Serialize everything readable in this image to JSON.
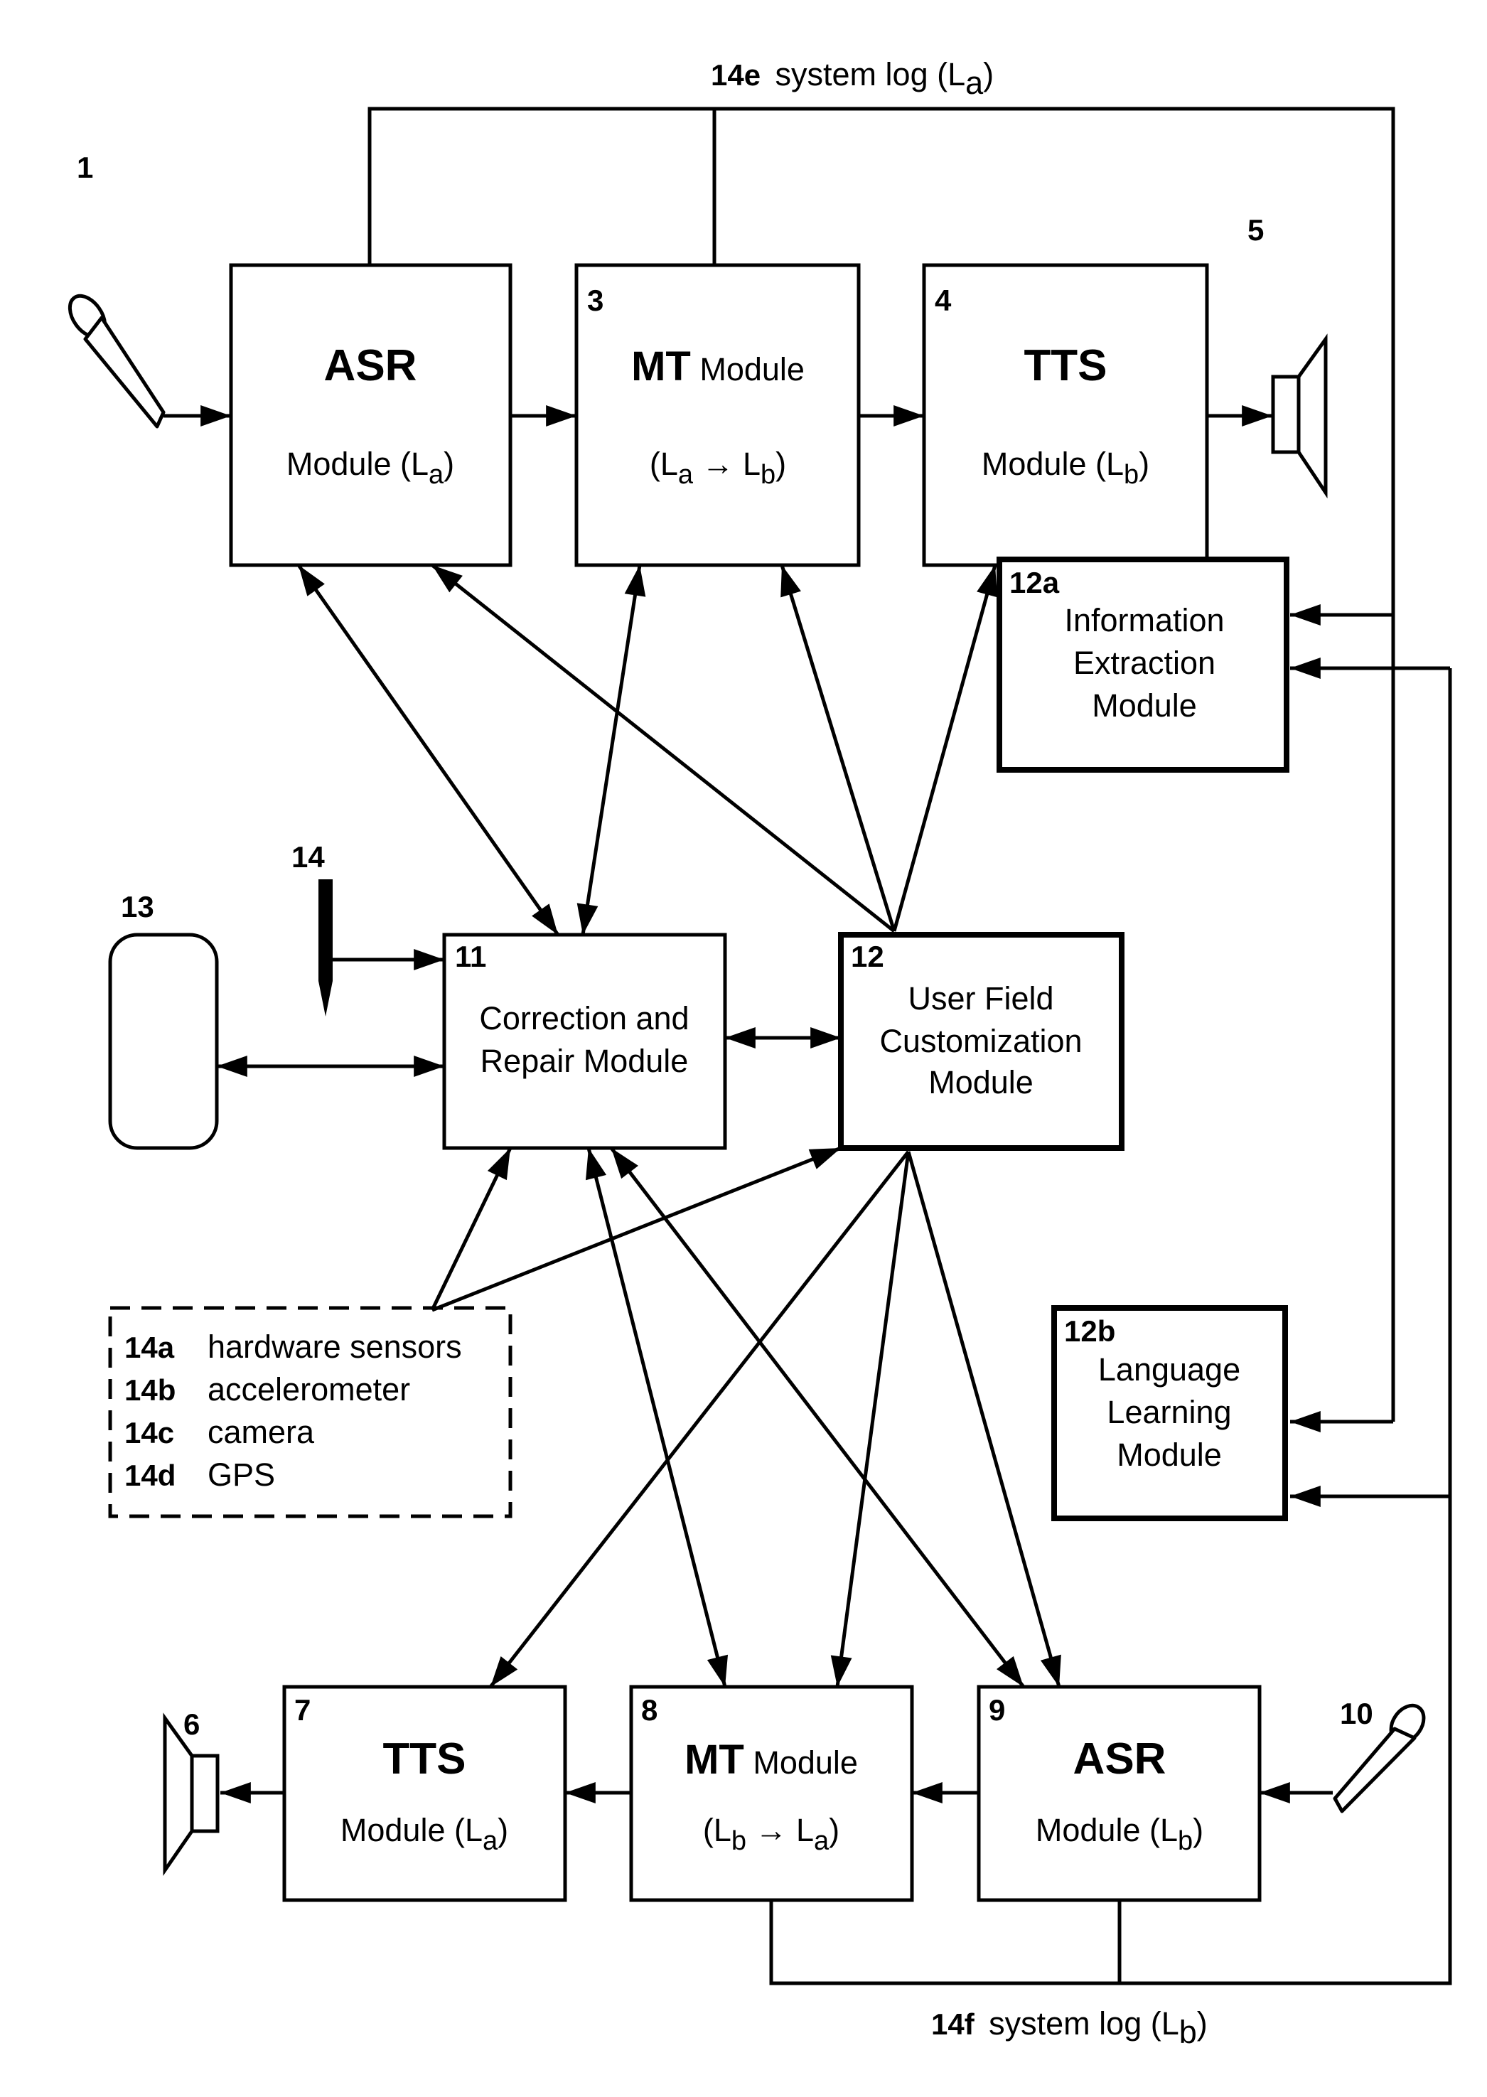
{
  "figure": {
    "type": "block-diagram",
    "description": "Speech-to-speech translation system with user field customization"
  },
  "system_logs": {
    "top": {
      "ref": "14e",
      "label": "system log (L",
      "sub": "a",
      "close": ")"
    },
    "bottom": {
      "ref": "14f",
      "label": "system log (L",
      "sub": "b",
      "close": ")"
    }
  },
  "devices": {
    "mic_top": {
      "ref": "1",
      "icon": "microphone-icon"
    },
    "speaker_top": {
      "ref": "5",
      "icon": "speaker-icon"
    },
    "speaker_bottom": {
      "ref": "6",
      "icon": "speaker-icon"
    },
    "mic_bottom": {
      "ref": "10",
      "icon": "microphone-icon"
    },
    "display": {
      "ref": "13",
      "icon": "display-device-icon"
    },
    "pen": {
      "ref": "14",
      "icon": "stylus-pen-icon"
    }
  },
  "modules": {
    "asr_a": {
      "ref": "",
      "title": "ASR",
      "line2": "Module (L",
      "sub": "a",
      "close": ")"
    },
    "mt_ab": {
      "ref": "3",
      "title": "MT",
      "title_rest": " Module",
      "line2_open": "(L",
      "sub1": "a",
      "arrow": " → L",
      "sub2": "b",
      "close": ")"
    },
    "tts_b": {
      "ref": "4",
      "title": "TTS",
      "line2": "Module (L",
      "sub": "b",
      "close": ")"
    },
    "tts_a": {
      "ref": "7",
      "title": "TTS",
      "line2": "Module (L",
      "sub": "a",
      "close": ")"
    },
    "mt_ba": {
      "ref": "8",
      "title": "MT",
      "title_rest": " Module",
      "line2_open": "(L",
      "sub1": "b",
      "arrow": " → L",
      "sub2": "a",
      "close": ")"
    },
    "asr_b": {
      "ref": "9",
      "title": "ASR",
      "line2": "Module (L",
      "sub": "b",
      "close": ")"
    },
    "correction": {
      "ref": "11",
      "lines": [
        "Correction and",
        "Repair Module"
      ]
    },
    "user_field": {
      "ref": "12",
      "lines": [
        "User Field",
        "Customization",
        "Module"
      ]
    },
    "info_extraction": {
      "ref": "12a",
      "lines": [
        "Information",
        "Extraction",
        "Module"
      ]
    },
    "language_learning": {
      "ref": "12b",
      "lines": [
        "Language",
        "Learning",
        "Module"
      ]
    }
  },
  "sensors": {
    "items": [
      {
        "ref": "14a",
        "label": "hardware sensors"
      },
      {
        "ref": "14b",
        "label": "accelerometer"
      },
      {
        "ref": "14c",
        "label": "camera"
      },
      {
        "ref": "14d",
        "label": "GPS"
      }
    ]
  }
}
